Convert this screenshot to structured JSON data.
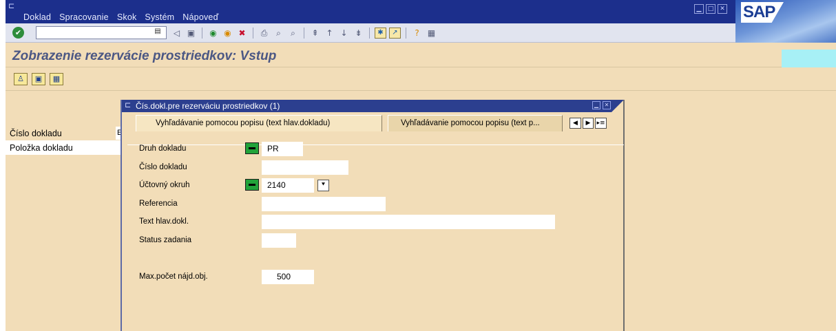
{
  "menu": {
    "items": [
      "Doklad",
      "Spracovanie",
      "Skok",
      "Systém",
      "Nápoveď"
    ]
  },
  "logo": {
    "text": "SAP"
  },
  "toolbar": {
    "command_value": "",
    "icons": [
      "ok-icon",
      "command-dropdown-icon",
      "back-icon",
      "save-icon",
      "green-back-icon",
      "exit-icon",
      "cancel-icon",
      "print-icon",
      "find-icon",
      "find-next-icon",
      "first-page-icon",
      "previous-page-icon",
      "next-page-icon",
      "last-page-icon",
      "create-session-icon",
      "shortcut-icon",
      "help-icon",
      "layout-icon"
    ]
  },
  "title": "Zobrazenie rezervácie prostriedkov: Vstup",
  "app_toolbar": {
    "icons": [
      "user-icon",
      "display-icon",
      "grid-icon"
    ]
  },
  "background_form": {
    "rows": [
      {
        "label": "Číslo dokladu",
        "value": "E"
      },
      {
        "label": "Položka dokladu",
        "value": ""
      }
    ]
  },
  "popup": {
    "title": "Čís.dokl.pre rezerváciu prostriedkov (1)",
    "tabs": [
      {
        "label": "Vyhľadávanie pomocou popisu (text hlav.dokladu)"
      },
      {
        "label": "Vyhľadávanie pomocou popisu (text p..."
      }
    ],
    "fields": {
      "druh_dokladu": {
        "label": "Druh dokladu",
        "value": "PR"
      },
      "cislo_dokladu": {
        "label": "Číslo dokladu",
        "value": ""
      },
      "uctovny_okruh": {
        "label": "Účtovný okruh",
        "value": "2140"
      },
      "referencia": {
        "label": "Referencia",
        "value": ""
      },
      "text_hlav": {
        "label": "Text hlav.dokl.",
        "value": ""
      },
      "status": {
        "label": "Status zadania",
        "value": ""
      },
      "max_pocet": {
        "label": "Max.počet nájd.obj.",
        "value": "500"
      }
    }
  },
  "colors": {
    "menubar": "#1c2f8c",
    "background": "#f2ddb8",
    "title_text": "#4b5784",
    "required_indicator": "#22a33a",
    "accent_cyan": "#a7f0f6"
  }
}
